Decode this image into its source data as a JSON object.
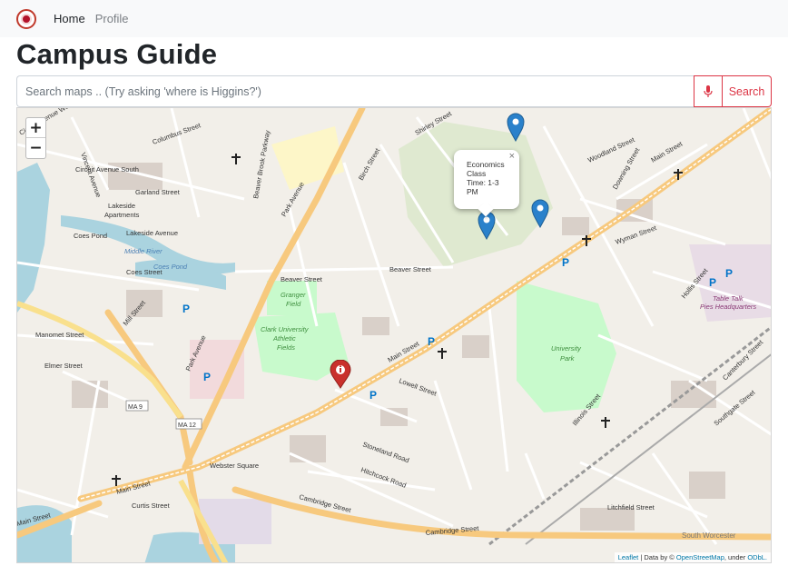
{
  "nav": {
    "home_label": "Home",
    "profile_label": "Profile"
  },
  "page": {
    "title": "Campus Guide"
  },
  "search": {
    "placeholder": "Search maps .. (Try asking 'where is Higgins?')",
    "button_label": "Search"
  },
  "map": {
    "zoom_in_label": "+",
    "zoom_out_label": "−",
    "popup": {
      "line1": "Economics",
      "line2": "Class",
      "line3": "Time: 1-3",
      "line4": "PM",
      "close": "×"
    },
    "attribution": {
      "leaflet": "Leaflet",
      "sep1": " | Data by © ",
      "osm": "OpenStreetMap",
      "sep2": ", under ",
      "odbl": "ODbL."
    },
    "labels": {
      "circuit_ave": "Circuit Avenue West",
      "columbus": "Columbus Street",
      "vincent": "Vincent Avenue",
      "circuit_south": "Circuit Avenue South",
      "garland": "Garland Street",
      "lakeside_1": "Lakeside",
      "lakeside_2": "Apartments",
      "lakeside_ave": "Lakeside Avenue",
      "coes_pond_top": "Coes Pond",
      "middle_river": "Middle River",
      "coes_pond": "Coes Pond",
      "coes_street": "Coes Street",
      "mill_street": "Mill Street",
      "manomet": "Manomet Street",
      "elmer": "Elmer Street",
      "park_avenue": "Park Avenue",
      "park_avenue_2": "Park Avenue",
      "beaver_street": "Beaver Street",
      "beaver_street_2": "Beaver Street",
      "granger_1": "Granger",
      "granger_2": "Field",
      "clark_1": "Clark University",
      "clark_2": "Athletic",
      "clark_3": "Fields",
      "main_street": "Main Street",
      "main_street_2": "Main Street",
      "main_street_3": "Main Street",
      "main_street_4": "Main Street",
      "university_1": "University",
      "university_2": "Park",
      "webster": "Webster Square",
      "ma9": "MA 9",
      "ma12": "MA 12",
      "cambridge": "Cambridge Street",
      "cambridge_2": "Cambridge Street",
      "south_worcester": "South Worcester",
      "talk_1": "Table Talk",
      "talk_2": "Pies Headquarters",
      "woodland": "Woodland Street",
      "downing": "Downing Street",
      "wyman": "Wyman Street",
      "shirley": "Shirley Street",
      "lowell": "Lowell Street",
      "birch": "Birch Street",
      "hollis": "Hollis Street",
      "illinois": "Illinois Street",
      "litchfield": "Litchfield Street",
      "curtis": "Curtis Street",
      "stoneland": "Stoneland Road",
      "hitchcock": "Hitchcock Road",
      "southgate": "Southgate Street",
      "canterbury": "Canterbury Street",
      "camp_street": "Beaver Brook Parkway"
    }
  }
}
